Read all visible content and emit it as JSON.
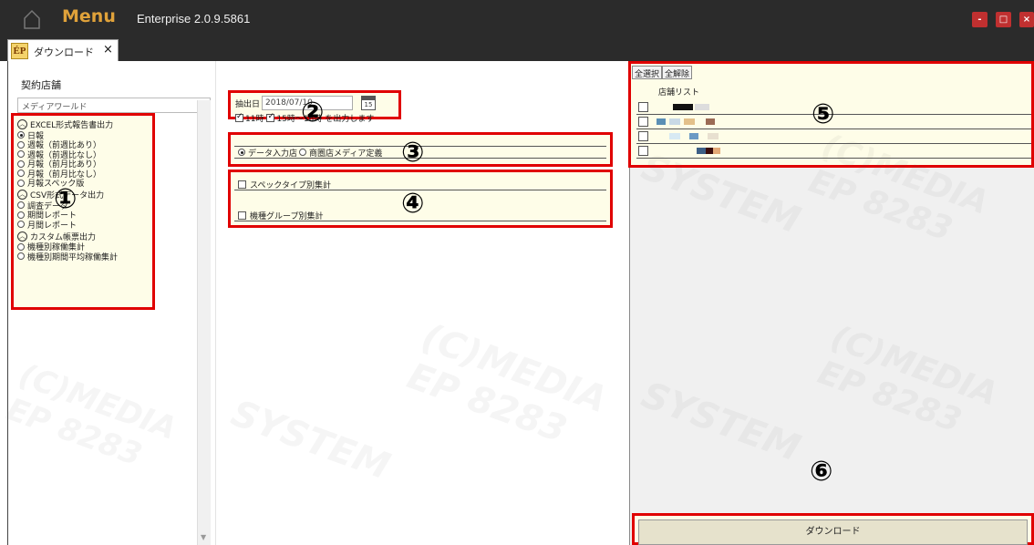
{
  "titlebar": {
    "menu_label": "Menu",
    "app_title": "Enterprise 2.0.9.5861",
    "minimize": "-",
    "maximize": "□",
    "close": "×"
  },
  "tab": {
    "logo": "ÉP",
    "label": "ダウンロード",
    "close": "×"
  },
  "left": {
    "store_label": "契約店舗",
    "media_select": "メディアワールド",
    "groups": [
      {
        "label": "EXCEL形式報告書出力",
        "items": [
          "日報",
          "週報（前週比あり）",
          "週報（前週比なし）",
          "月報（前月比あり）",
          "月報（前月比なし）",
          "月報スペック版"
        ]
      },
      {
        "label": "CSV形式データ出力",
        "items": [
          "調査データ",
          "期間レポート",
          "月間レポート"
        ]
      },
      {
        "label": "カスタム帳票出力",
        "items": [
          "機種別稼働集計",
          "機種別期間平均稼働集計"
        ]
      }
    ]
  },
  "middle": {
    "date_label": "抽出日",
    "date_value": "2018/07/10",
    "calendar_day": "15",
    "time_from": "11時",
    "time_to": "15時～16時",
    "time_suffix": "を出力します",
    "store_type_options": [
      "データ入力店",
      "商圏店メディア定義"
    ],
    "agg_options": [
      "スペックタイプ別集計",
      "機種グループ別集計"
    ]
  },
  "right": {
    "select_all": "全選択",
    "deselect_all": "全解除",
    "list_header": "店舗リスト",
    "row_count": 4,
    "download_label": "ダウンロード"
  },
  "markers": [
    "①",
    "②",
    "③",
    "④",
    "⑤",
    "⑥"
  ],
  "watermark": {
    "line1": "(C)MEDIA",
    "line2": "SYSTEM",
    "line3": "EP 8283"
  },
  "colors": {
    "highlight_border": "#e00000",
    "panel_fill": "#fefde8",
    "titlebar_bg": "#2b2b2b",
    "menu_color": "#e0a23a",
    "window_button": "#c03030"
  }
}
